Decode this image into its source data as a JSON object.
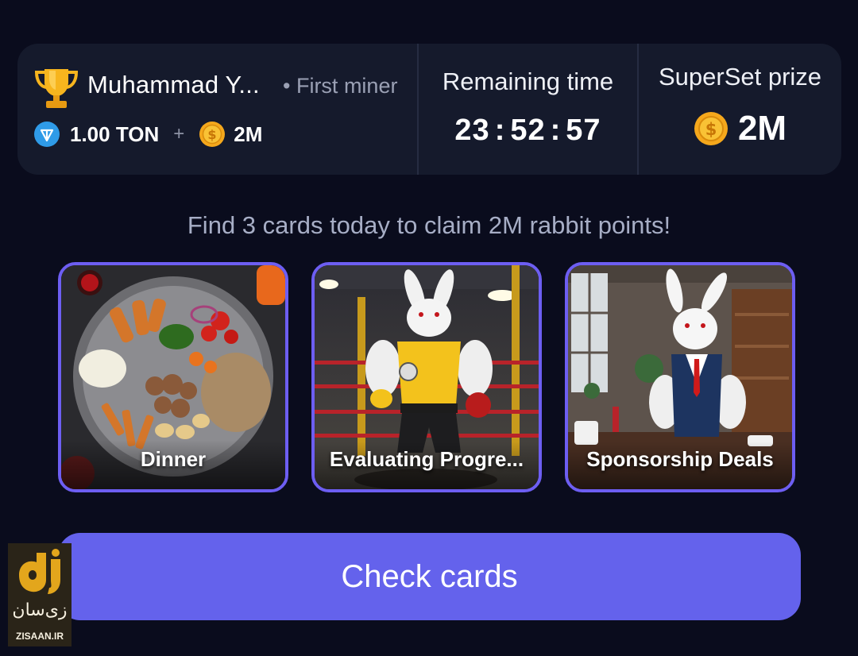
{
  "winner": {
    "name": "Muhammad Y...",
    "rank": "• First miner",
    "ton_amount": "1.00 TON",
    "plus": "+",
    "coin_amount": "2M"
  },
  "remaining": {
    "label": "Remaining time",
    "hours": "23",
    "minutes": "52",
    "seconds": "57",
    "separator": ":"
  },
  "prize": {
    "label": "SuperSet prize",
    "amount": "2M"
  },
  "instruction": "Find 3 cards today to claim 2M rabbit points!",
  "cards": [
    {
      "title": "Dinner",
      "image": "dinner-plate"
    },
    {
      "title": "Evaluating Progre...",
      "image": "rabbit-boxer-gym"
    },
    {
      "title": "Sponsorship Deals",
      "image": "rabbit-business-office"
    }
  ],
  "check_button": {
    "label": "Check cards"
  },
  "watermark": {
    "script": "زی‌سان",
    "text": "ZISAAN.IR"
  },
  "colors": {
    "background": "#0a0c1d",
    "panel": "#151a2c",
    "accent": "#6462ec",
    "card_border": "#6d5ef2",
    "coin": "#f5a81c",
    "ton": "#2f9be8"
  },
  "icons": [
    "trophy-icon",
    "ton-icon",
    "coin-icon"
  ]
}
